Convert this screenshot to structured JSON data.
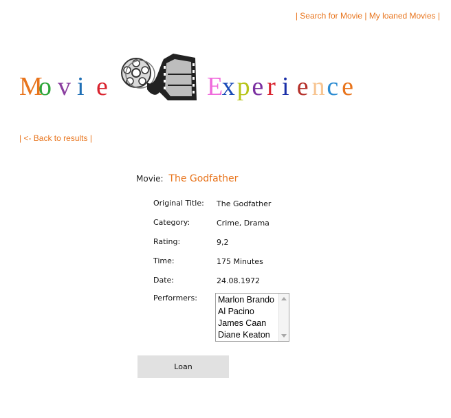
{
  "nav": {
    "search_link": "Search for Movie",
    "loaned_link": "My loaned Movies",
    "sep": "|"
  },
  "logo": {
    "word1": [
      "M",
      "o",
      "v",
      "i",
      "e"
    ],
    "word1_colors": [
      "#e8741c",
      "#2ea63a",
      "#8b3fa0",
      "#1f6fb5",
      "#d9232e"
    ],
    "word2": [
      "E",
      "x",
      "p",
      "e",
      "r",
      "i",
      "e",
      "n",
      "c",
      "e"
    ],
    "word2_colors": [
      "#f06bdc",
      "#1a4bb8",
      "#b7c41a",
      "#7a2fa0",
      "#d9232e",
      "#1a2fa8",
      "#b5312b",
      "#f7c592",
      "#2b8bd1",
      "#e8741c"
    ]
  },
  "back_link": "| <- Back to results |",
  "movie": {
    "label": "Movie:",
    "title": "The Godfather"
  },
  "details": [
    {
      "label": "Original Title:",
      "value": "The Godfather"
    },
    {
      "label": "Category:",
      "value": "Crime, Drama"
    },
    {
      "label": "Rating:",
      "value": "9,2"
    },
    {
      "label": "Time:",
      "value": "175 Minutes"
    },
    {
      "label": "Date:",
      "value": "24.08.1972"
    }
  ],
  "performers_label": "Performers:",
  "performers": [
    "Marlon Brando",
    "Al Pacino",
    "James Caan",
    "Diane Keaton"
  ],
  "loan_button": "Loan",
  "colors": {
    "accent": "#e8741c",
    "button_bg": "#e1e1e1"
  },
  "icons": {
    "logo_image": "film-reel-icon"
  }
}
